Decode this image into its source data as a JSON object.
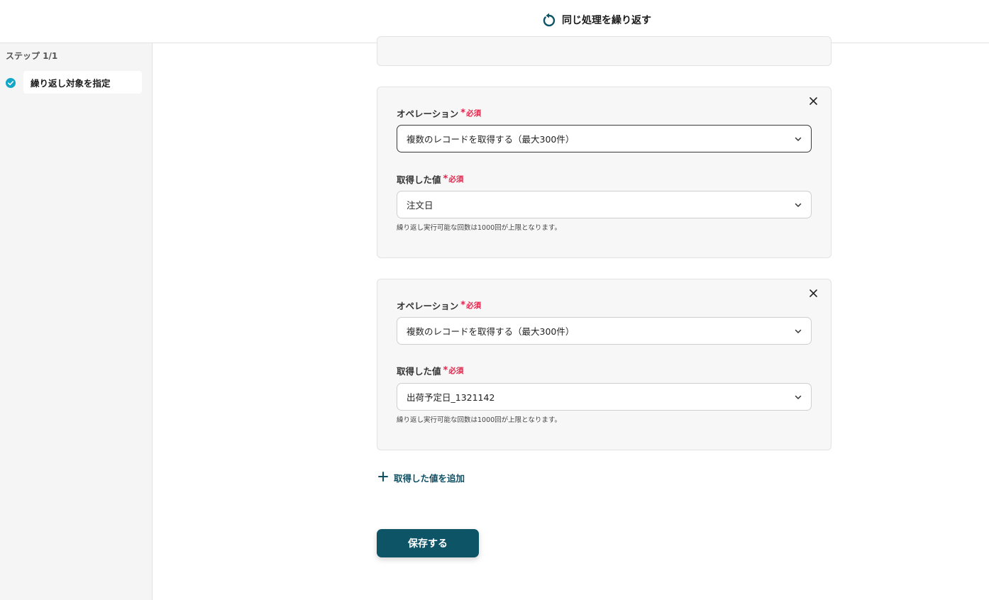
{
  "header": {
    "title": "同じ処理を繰り返す"
  },
  "sidebar": {
    "step_count": "ステップ 1/1",
    "steps": [
      {
        "label": "繰り返し対象を指定",
        "status": "completed"
      }
    ]
  },
  "form": {
    "cards": [
      {
        "operation_label": "オペレーション",
        "operation_required": "必須",
        "operation_value": "複数のレコードを取得する（最大300件）",
        "value_label": "取得した値",
        "value_required": "必須",
        "value_value": "注文日",
        "hint": "繰り返し実行可能な回数は1000回が上限となります。"
      },
      {
        "operation_label": "オペレーション",
        "operation_required": "必須",
        "operation_value": "複数のレコードを取得する（最大300件）",
        "value_label": "取得した値",
        "value_required": "必須",
        "value_value": "出荷予定日_1321142",
        "hint": "繰り返し実行可能な回数は1000回が上限となります。"
      }
    ],
    "add_value_label": "取得した値を追加",
    "save_label": "保存する"
  },
  "colors": {
    "accent": "#0d5467",
    "required": "#e0244a",
    "check": "#12a6c7"
  },
  "icons": {
    "header": "repeat-icon",
    "step": "check-circle-icon",
    "close": "close-icon",
    "select": "chevron-down-icon",
    "add": "plus-icon"
  }
}
